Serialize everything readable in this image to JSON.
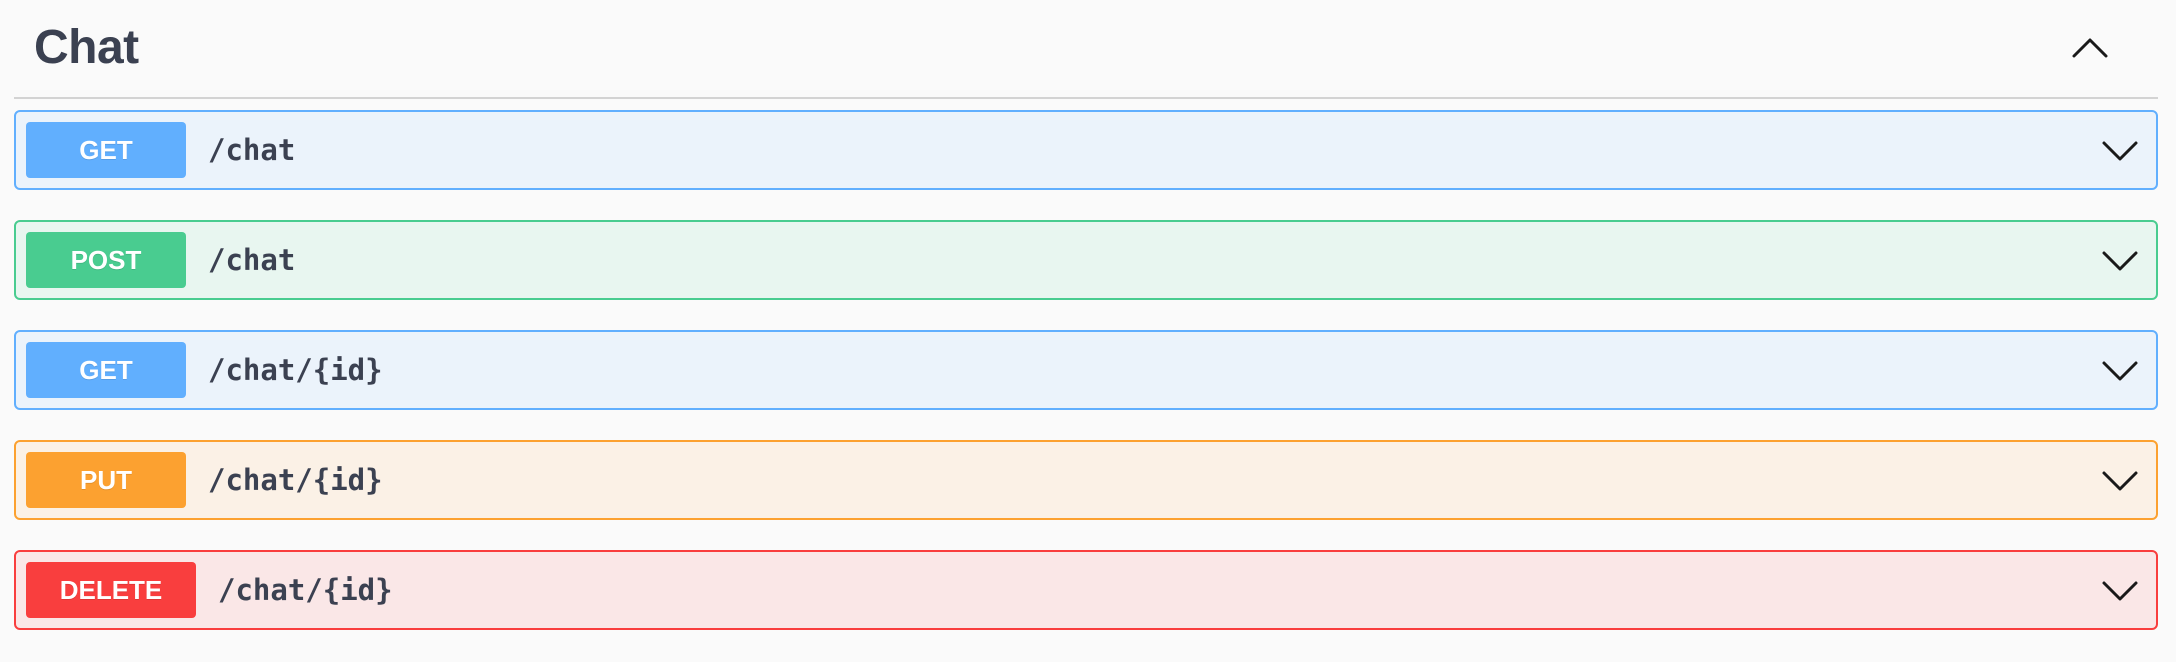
{
  "section": {
    "title": "Chat",
    "toggle_icon": "chevron-up-icon"
  },
  "operations": [
    {
      "method": "GET",
      "path": "/chat",
      "expand_icon": "chevron-down-icon"
    },
    {
      "method": "POST",
      "path": "/chat",
      "expand_icon": "chevron-down-icon"
    },
    {
      "method": "GET",
      "path": "/chat/{id}",
      "expand_icon": "chevron-down-icon"
    },
    {
      "method": "PUT",
      "path": "/chat/{id}",
      "expand_icon": "chevron-down-icon"
    },
    {
      "method": "DELETE",
      "path": "/chat/{id}",
      "expand_icon": "chevron-down-icon"
    }
  ],
  "colors": {
    "get": "#61affe",
    "post": "#49cc90",
    "put": "#fca130",
    "delete": "#f93e3e",
    "text": "#3b4151"
  }
}
